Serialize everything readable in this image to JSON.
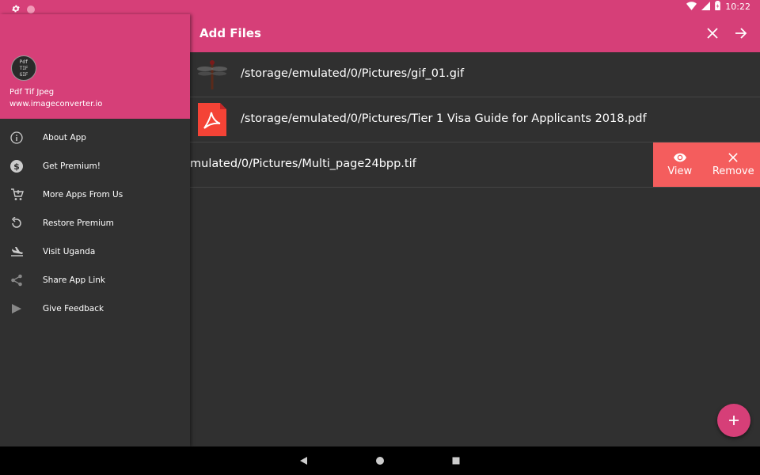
{
  "status_bar": {
    "time": "10:22",
    "icons": [
      "settings-icon",
      "notification-dot-icon",
      "wifi-icon",
      "signal-icon",
      "battery-icon"
    ]
  },
  "app_bar": {
    "title": "Add Files",
    "actions": [
      "close-icon",
      "arrow-forward-icon"
    ]
  },
  "drawer": {
    "app_name": "Pdf Tif Jpeg",
    "website": "www.imageconverter.io",
    "logo_text": [
      "Pdf",
      "TIF",
      "GIF"
    ],
    "items": [
      {
        "label": "About App",
        "icon": "info-icon"
      },
      {
        "label": "Get Premium!",
        "icon": "dollar-icon"
      },
      {
        "label": "More Apps From Us",
        "icon": "cart-icon"
      },
      {
        "label": "Restore Premium",
        "icon": "restore-icon"
      },
      {
        "label": "Visit Uganda",
        "icon": "plane-icon"
      },
      {
        "label": "Share App Link",
        "icon": "share-icon"
      },
      {
        "label": "Give Feedback",
        "icon": "send-icon"
      }
    ]
  },
  "files": [
    {
      "path": "/storage/emulated/0/Pictures/gif_01.gif",
      "thumb": "dragonfly-thumbnail"
    },
    {
      "path": "/storage/emulated/0/Pictures/Tier 1 Visa Guide for Applicants 2018.pdf",
      "thumb": "pdf-icon"
    },
    {
      "path": "mulated/0/Pictures/Multi_page24bpp.tif",
      "thumb": ""
    }
  ],
  "swipe_actions": {
    "view": "View",
    "remove": "Remove"
  },
  "colors": {
    "primary": "#d63f78",
    "background": "#303030",
    "swipe": "#f45d5d"
  }
}
